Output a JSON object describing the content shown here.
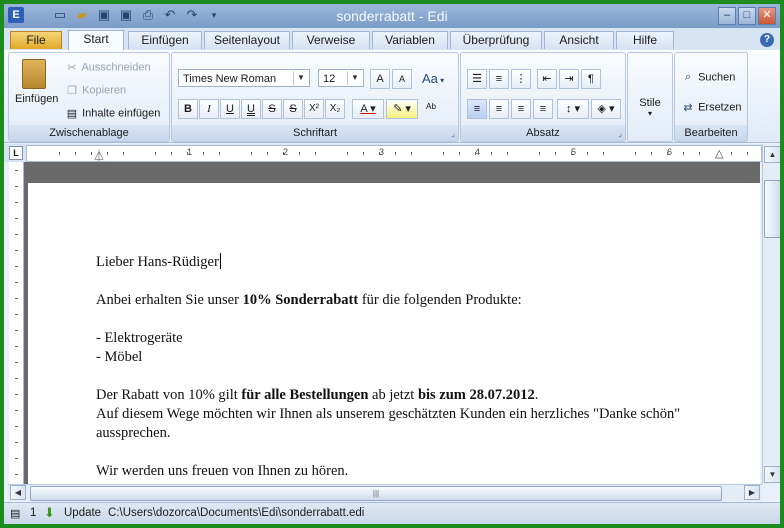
{
  "window": {
    "title": "sonderrabatt - Edi",
    "app_logo": "E"
  },
  "quick_access": [
    "new-icon",
    "open-icon",
    "save-icon",
    "save-all-icon",
    "print-icon",
    "undo-icon",
    "redo-icon",
    "customize-icon"
  ],
  "tabs": [
    "Datei",
    "Start",
    "Einfügen",
    "Seitenlayout",
    "Verweise",
    "Variablen",
    "Überprüfung",
    "Ansicht",
    "Hilfe"
  ],
  "tab_labels": {
    "file": "File",
    "start": "Start",
    "insert": "Einfügen",
    "layout": "Seitenlayout",
    "references": "Verweise",
    "variables": "Variablen",
    "review": "Überprüfung",
    "view": "Ansicht",
    "help": "Hilfe"
  },
  "ribbon": {
    "clipboard": {
      "label": "Zwischenablage",
      "paste": "Einfügen",
      "cut": "Ausschneiden",
      "copy": "Kopieren",
      "paste_content": "Inhalte einfügen"
    },
    "font": {
      "label": "Schriftart",
      "family": "Times New Roman",
      "size": "12",
      "change_case": "Aa"
    },
    "paragraph": {
      "label": "Absatz"
    },
    "styles": {
      "label": "Stile"
    },
    "editing": {
      "label": "Bearbeiten",
      "find": "Suchen",
      "replace": "Ersetzen"
    }
  },
  "ruler": {
    "numbers": [
      "1",
      "2",
      "3",
      "4",
      "5",
      "6"
    ]
  },
  "document": {
    "salutation": "Lieber Hans-Rüdiger",
    "line1_pre": "Anbei  erhalten Sie unser ",
    "line1_bold": "10% Sonderrabatt",
    "line1_post": " für die folgenden Produkte:",
    "item1": "- Elektrogeräte",
    "item2": "- Möbel",
    "line2_pre": "Der Rabatt von 10% gilt ",
    "line2_bold1": "für alle Bestellungen",
    "line2_mid": " ab jetzt ",
    "line2_bold2": "bis zum 28.07.2012",
    "line2_post": ".",
    "line3": "Auf diesem Wege möchten wir Ihnen als unserem geschätzten Kunden ein herzliches \"Danke schön\" aussprechen.",
    "line4": "Wir werden uns freuen von Ihnen zu hören."
  },
  "status": {
    "page": "1",
    "update": "Update",
    "path": "C:\\Users\\dozorca\\Documents\\Edi\\sonderrabatt.edi"
  },
  "colors": {
    "frame": "#1d8c1f",
    "accent": "#3a6ab2"
  }
}
